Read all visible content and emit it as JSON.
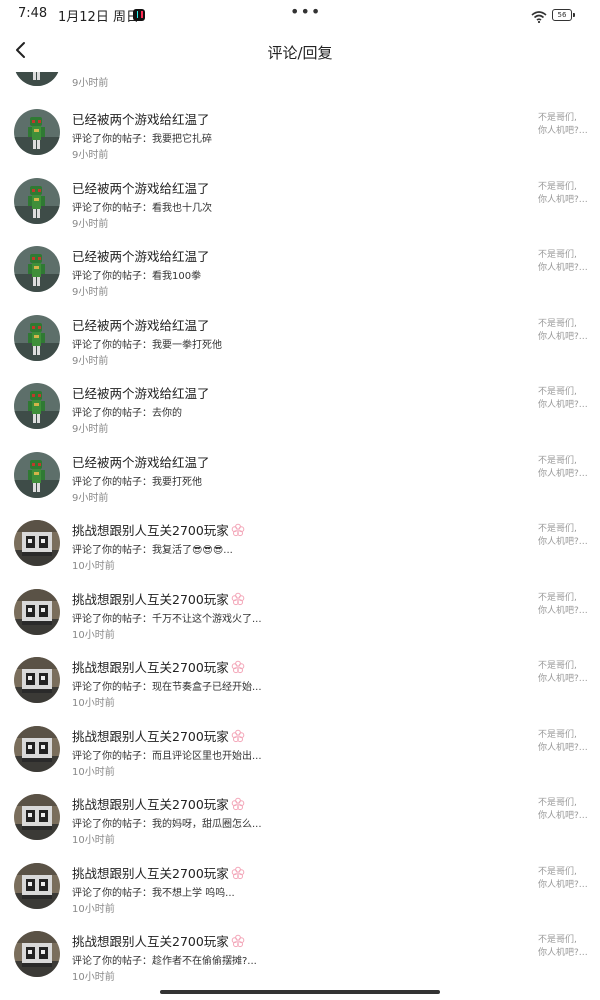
{
  "status_bar": {
    "time": "7:48",
    "date": "1月12日 周日",
    "dots": "•••",
    "battery": "56"
  },
  "nav": {
    "title": "评论/回复"
  },
  "partial_item": {
    "time": "9小时前"
  },
  "items": [
    {
      "user": "已经被两个游戏给红温了",
      "comment": "评论了你的帖子：我要把它扎碎",
      "time": "9小时前",
      "post_line1": "不是哥们,",
      "post_line2": "你人机吧?…",
      "avatar": "green",
      "flower": false
    },
    {
      "user": "已经被两个游戏给红温了",
      "comment": "评论了你的帖子：看我也十几次",
      "time": "9小时前",
      "post_line1": "不是哥们,",
      "post_line2": "你人机吧?…",
      "avatar": "green",
      "flower": false
    },
    {
      "user": "已经被两个游戏给红温了",
      "comment": "评论了你的帖子：看我100拳",
      "time": "9小时前",
      "post_line1": "不是哥们,",
      "post_line2": "你人机吧?…",
      "avatar": "green",
      "flower": false
    },
    {
      "user": "已经被两个游戏给红温了",
      "comment": "评论了你的帖子：我要一拳打死他",
      "time": "9小时前",
      "post_line1": "不是哥们,",
      "post_line2": "你人机吧?…",
      "avatar": "green",
      "flower": false
    },
    {
      "user": "已经被两个游戏给红温了",
      "comment": "评论了你的帖子：去你的",
      "time": "9小时前",
      "post_line1": "不是哥们,",
      "post_line2": "你人机吧?…",
      "avatar": "green",
      "flower": false
    },
    {
      "user": "已经被两个游戏给红温了",
      "comment": "评论了你的帖子：我要打死他",
      "time": "9小时前",
      "post_line1": "不是哥们,",
      "post_line2": "你人机吧?…",
      "avatar": "green",
      "flower": false
    },
    {
      "user": "挑战想跟别人互关2700玩家",
      "comment": "评论了你的帖子：我复活了😎😎😎...",
      "time": "10小时前",
      "post_line1": "不是哥们,",
      "post_line2": "你人机吧?…",
      "avatar": "dark",
      "flower": true
    },
    {
      "user": "挑战想跟别人互关2700玩家",
      "comment": "评论了你的帖子：千万不让这个游戏火了...",
      "time": "10小时前",
      "post_line1": "不是哥们,",
      "post_line2": "你人机吧?…",
      "avatar": "dark",
      "flower": true
    },
    {
      "user": "挑战想跟别人互关2700玩家",
      "comment": "评论了你的帖子：现在节奏盒子已经开始...",
      "time": "10小时前",
      "post_line1": "不是哥们,",
      "post_line2": "你人机吧?…",
      "avatar": "dark",
      "flower": true
    },
    {
      "user": "挑战想跟别人互关2700玩家",
      "comment": "评论了你的帖子：而且评论区里也开始出...",
      "time": "10小时前",
      "post_line1": "不是哥们,",
      "post_line2": "你人机吧?…",
      "avatar": "dark",
      "flower": true
    },
    {
      "user": "挑战想跟别人互关2700玩家",
      "comment": "评论了你的帖子：我的妈呀，甜瓜圈怎么...",
      "time": "10小时前",
      "post_line1": "不是哥们,",
      "post_line2": "你人机吧?…",
      "avatar": "dark",
      "flower": true
    },
    {
      "user": "挑战想跟别人互关2700玩家",
      "comment": "评论了你的帖子：我不想上学  呜呜...",
      "time": "10小时前",
      "post_line1": "不是哥们,",
      "post_line2": "你人机吧?…",
      "avatar": "dark",
      "flower": true
    },
    {
      "user": "挑战想跟别人互关2700玩家",
      "comment": "评论了你的帖子：趁作者不在偷偷摆摊?...",
      "time": "10小时前",
      "post_line1": "不是哥们,",
      "post_line2": "你人机吧?…",
      "avatar": "dark",
      "flower": true
    }
  ]
}
